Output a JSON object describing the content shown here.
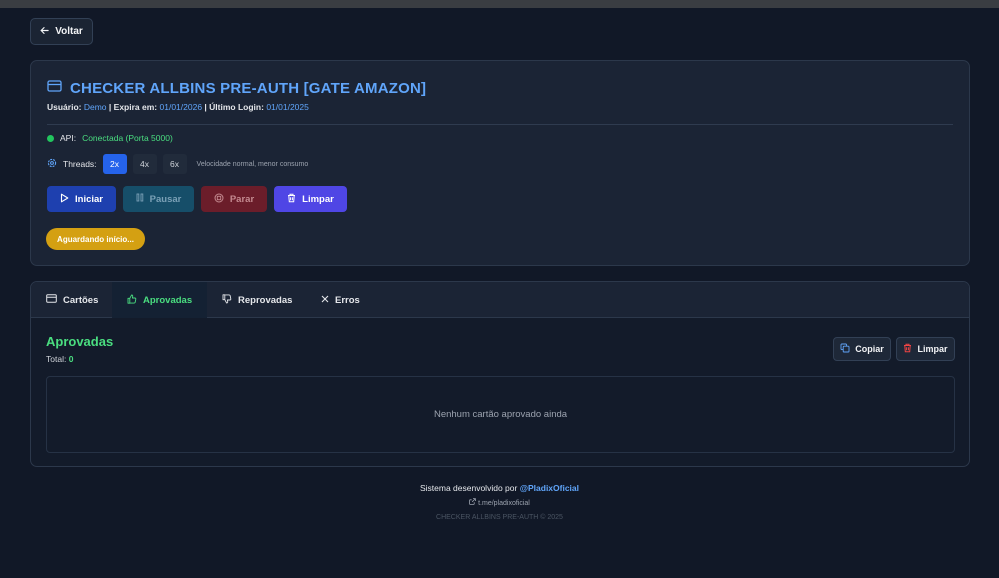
{
  "back_label": "Voltar",
  "checker": {
    "title": "CHECKER ALLBINS PRE-AUTH [GATE AMAZON]",
    "user_label": "Usuário:",
    "user_value": "Demo",
    "expires_label": "| Expira em:",
    "expires_value": "01/01/2026",
    "last_login_label": "| Último Login:",
    "last_login_value": "01/01/2025"
  },
  "api": {
    "label": "API:",
    "status": "Conectada (Porta 5000)",
    "status_color": "#22c55e"
  },
  "threads": {
    "label": "Threads:",
    "options": [
      "2x",
      "4x",
      "6x"
    ],
    "selected": "2x",
    "description": "Velocidade normal, menor consumo"
  },
  "actions": {
    "start": "Iniciar",
    "pause": "Pausar",
    "stop": "Parar",
    "clear": "Limpar"
  },
  "status_pill": "Aguardando início...",
  "tabs": [
    {
      "label": "Cartões",
      "icon": "card-icon"
    },
    {
      "label": "Aprovadas",
      "icon": "thumbs-up-icon",
      "active": true
    },
    {
      "label": "Reprovadas",
      "icon": "thumbs-down-icon"
    },
    {
      "label": "Erros",
      "icon": "close-icon"
    }
  ],
  "section": {
    "title": "Aprovadas",
    "total_label": "Total:",
    "total_value": "0",
    "copy_label": "Copiar",
    "clear_label": "Limpar",
    "empty_message": "Nenhum cartão aprovado ainda"
  },
  "footer": {
    "dev_text": "Sistema desenvolvido por",
    "dev_handle": "@PladixOficial",
    "link": "t.me/pladixoficial",
    "copyright": "CHECKER ALLBINS PRE-AUTH © 2025"
  },
  "colors": {
    "accent": "#60a5fa",
    "success": "#4ade80",
    "primary": "#2563eb",
    "warning": "#d4a012"
  }
}
